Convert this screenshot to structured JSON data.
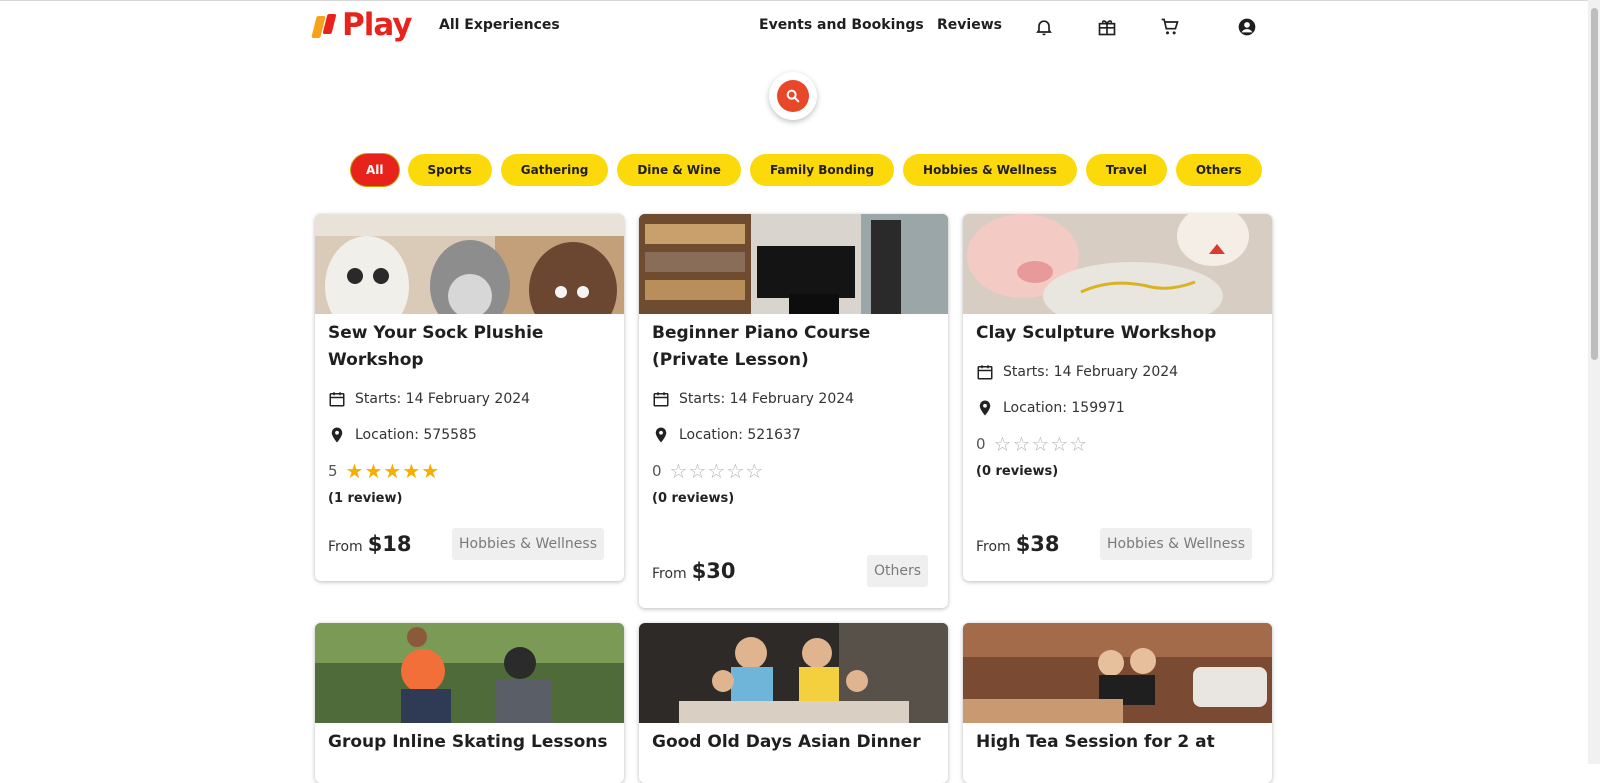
{
  "header": {
    "logo_text": "Play",
    "nav_all": "All Experiences",
    "nav_events": "Events and Bookings",
    "nav_reviews": "Reviews",
    "icons": [
      "bell-icon",
      "gift-icon",
      "cart-icon",
      "account-circle-icon"
    ]
  },
  "search": {
    "icon": "search-icon"
  },
  "categories": [
    "All",
    "Sports",
    "Gathering",
    "Dine & Wine",
    "Family Bonding",
    "Hobbies & Wellness",
    "Travel",
    "Others"
  ],
  "active_category": "All",
  "colors": {
    "brand_red": "#e8231c",
    "chip_yellow": "#fcd90a",
    "star": "#f6ae00",
    "search_red": "#e9472a"
  },
  "cards": [
    {
      "title": "Sew Your Sock Plushie Workshop",
      "starts": "Starts: 14 February 2024",
      "location": "Location: 575585",
      "rating": "5",
      "rating_value": 5,
      "reviews": "(1 review)",
      "from": "From",
      "price": "$18",
      "tag": "Hobbies & Wellness"
    },
    {
      "title": "Beginner Piano Course (Private Lesson)",
      "starts": "Starts: 14 February 2024",
      "location": "Location: 521637",
      "rating": "0",
      "rating_value": 0,
      "reviews": "(0 reviews)",
      "from": "From",
      "price": "$30",
      "tag": "Others"
    },
    {
      "title": "Clay Sculpture Workshop",
      "starts": "Starts: 14 February 2024",
      "location": "Location: 159971",
      "rating": "0",
      "rating_value": 0,
      "reviews": "(0 reviews)",
      "from": "From",
      "price": "$38",
      "tag": "Hobbies & Wellness"
    },
    {
      "title": "Group Inline Skating Lessons"
    },
    {
      "title": "Good Old Days Asian Dinner"
    },
    {
      "title": "High Tea Session for 2 at"
    }
  ]
}
